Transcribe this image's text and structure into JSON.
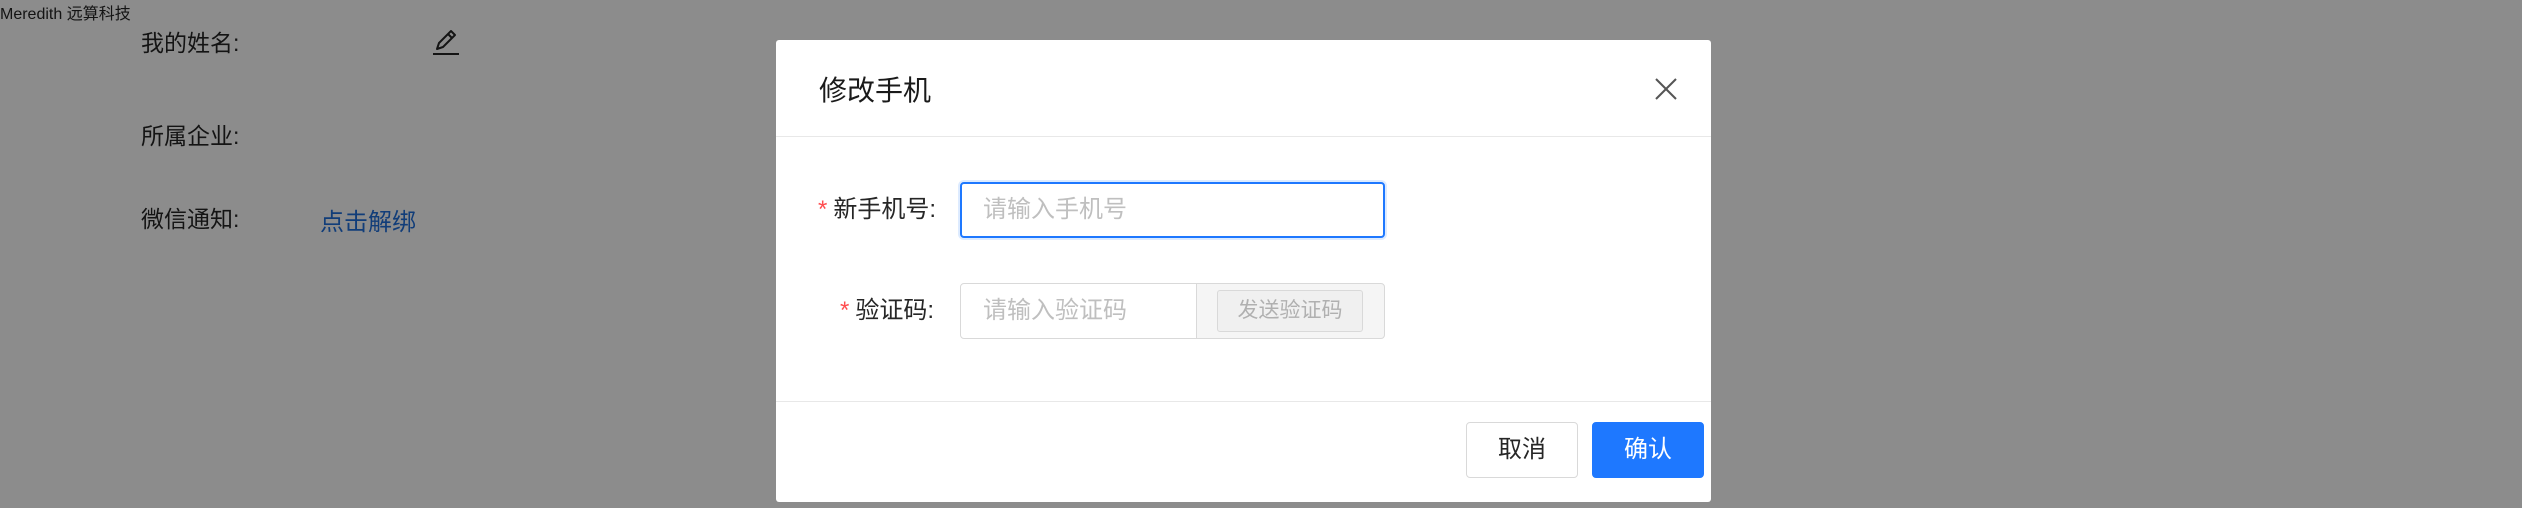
{
  "profile": {
    "name_label": "我的姓名:",
    "name_value": "Meredith",
    "company_label": "所属企业:",
    "company_value": "远算科技",
    "wechat_label": "微信通知:",
    "wechat_action": "点击解绑"
  },
  "modal": {
    "title": "修改手机",
    "phone_label": "新手机号:",
    "phone_placeholder": "请输入手机号",
    "code_label": "验证码:",
    "code_placeholder": "请输入验证码",
    "send_code": "发送验证码",
    "cancel": "取消",
    "confirm": "确认"
  },
  "icons": {
    "edit": "pencil-icon",
    "close": "close-icon"
  },
  "colors": {
    "primary": "#1e78ff",
    "link": "#1f6fdc",
    "required": "#ff4d4f"
  }
}
